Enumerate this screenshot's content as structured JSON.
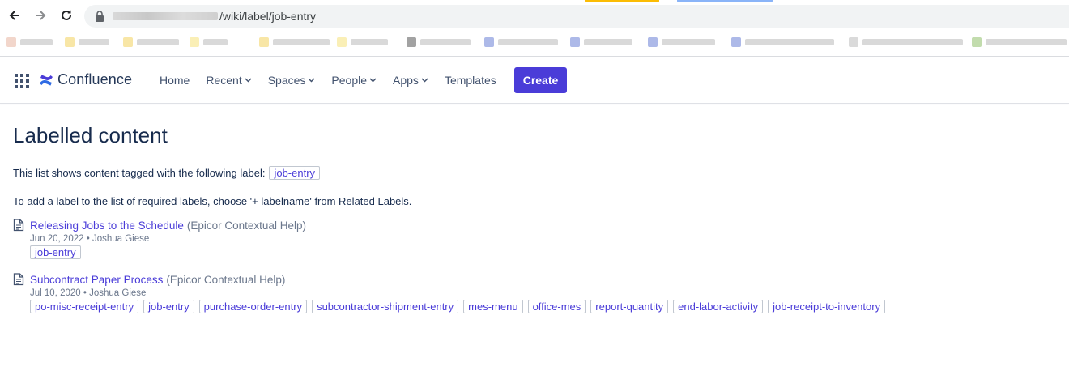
{
  "browser": {
    "url_path": "/wiki/label/job-entry",
    "tab_accents": [
      "#fbbc04",
      "#8ab4f8"
    ]
  },
  "header": {
    "product_name": "Confluence",
    "nav": [
      {
        "label": "Home",
        "dropdown": false
      },
      {
        "label": "Recent",
        "dropdown": true
      },
      {
        "label": "Spaces",
        "dropdown": true
      },
      {
        "label": "People",
        "dropdown": true
      },
      {
        "label": "Apps",
        "dropdown": true
      },
      {
        "label": "Templates",
        "dropdown": false
      }
    ],
    "create_label": "Create",
    "accent_color": "#4a3cd8"
  },
  "main": {
    "title": "Labelled content",
    "intro_text": "This list shows content tagged with the following label:",
    "current_label": "job-entry",
    "instruction": "To add a label to the list of required labels, choose '+ labelname' from Related Labels.",
    "results": [
      {
        "title": "Releasing Jobs to the Schedule",
        "space": "(Epicor Contextual Help)",
        "date": "Jun 20, 2022",
        "author": "Joshua Giese",
        "labels": [
          "job-entry"
        ]
      },
      {
        "title": "Subcontract Paper Process",
        "space": "(Epicor Contextual Help)",
        "date": "Jul 10, 2020",
        "author": "Joshua Giese",
        "labels": [
          "po-misc-receipt-entry",
          "job-entry",
          "purchase-order-entry",
          "subcontractor-shipment-entry",
          "mes-menu",
          "office-mes",
          "report-quantity",
          "end-labor-activity",
          "job-receipt-to-inventory"
        ]
      }
    ]
  }
}
